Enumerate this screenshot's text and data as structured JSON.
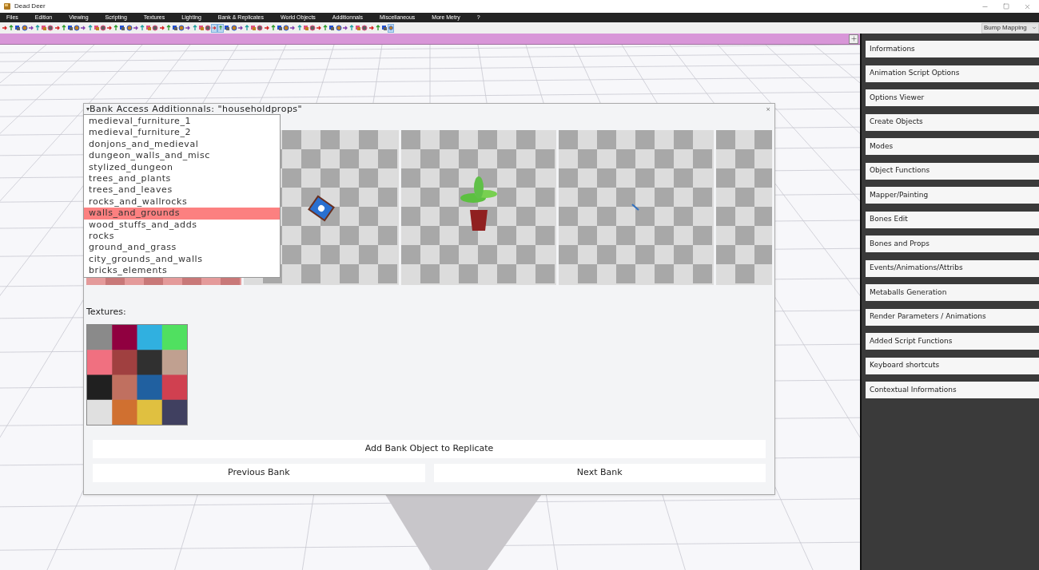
{
  "window": {
    "title": "Dead Deer"
  },
  "menu": [
    "Files",
    "Edition",
    "Viewing",
    "Scripting",
    "Textures",
    "Lighting",
    "Bank & Replicates",
    "World Objects",
    "Additionnals",
    "Miscellaneous",
    "More Metry",
    "?"
  ],
  "toolbar": {
    "tools": [
      {
        "selected": false
      },
      {
        "selected": false
      },
      {
        "selected": false
      },
      {
        "selected": false
      },
      {
        "selected": false
      },
      {
        "selected": false
      },
      {
        "selected": false
      },
      {
        "selected": false
      },
      {
        "selected": false
      },
      {
        "selected": false
      },
      {
        "selected": false
      },
      {
        "selected": false
      },
      {
        "selected": false
      },
      {
        "selected": false
      },
      {
        "selected": false
      },
      {
        "selected": false
      },
      {
        "selected": false
      },
      {
        "selected": false
      },
      {
        "selected": false
      },
      {
        "selected": false
      },
      {
        "selected": false
      },
      {
        "selected": false
      },
      {
        "selected": false
      },
      {
        "selected": false
      },
      {
        "selected": false
      },
      {
        "selected": false
      },
      {
        "selected": false
      },
      {
        "selected": false
      },
      {
        "selected": false
      },
      {
        "selected": false
      },
      {
        "selected": false
      },
      {
        "selected": false
      },
      {
        "selected": true
      },
      {
        "selected": true
      },
      {
        "selected": false
      },
      {
        "selected": false
      },
      {
        "selected": false
      },
      {
        "selected": false
      },
      {
        "selected": false
      },
      {
        "selected": false
      },
      {
        "selected": false
      },
      {
        "selected": false
      },
      {
        "selected": false
      },
      {
        "selected": false
      },
      {
        "selected": false
      },
      {
        "selected": false
      },
      {
        "selected": false
      },
      {
        "selected": false
      },
      {
        "selected": false
      },
      {
        "selected": false
      },
      {
        "selected": false
      },
      {
        "selected": false
      },
      {
        "selected": false
      },
      {
        "selected": false
      },
      {
        "selected": false
      },
      {
        "selected": false
      },
      {
        "selected": false
      },
      {
        "selected": false
      },
      {
        "selected": false
      },
      {
        "selected": true
      }
    ],
    "render_mode": "Bump Mapping"
  },
  "dialog": {
    "toggle": "▾",
    "title": "Bank Access Additionnals: \"householdprops\"",
    "close": "×",
    "banks": [
      {
        "label": "medieval_furniture_1",
        "selected": false
      },
      {
        "label": "medieval_furniture_2",
        "selected": false
      },
      {
        "label": "donjons_and_medieval",
        "selected": false
      },
      {
        "label": "dungeon_walls_and_misc",
        "selected": false
      },
      {
        "label": "stylized_dungeon",
        "selected": false
      },
      {
        "label": "trees_and_plants",
        "selected": false
      },
      {
        "label": "trees_and_leaves",
        "selected": false
      },
      {
        "label": "rocks_and_wallrocks",
        "selected": false
      },
      {
        "label": "walls_and_grounds",
        "selected": true
      },
      {
        "label": "wood_stuffs_and_adds",
        "selected": false
      },
      {
        "label": "rocks",
        "selected": false
      },
      {
        "label": "ground_and_grass",
        "selected": false
      },
      {
        "label": "city_grounds_and_walls",
        "selected": false
      },
      {
        "label": "bricks_elements",
        "selected": false
      }
    ],
    "textures_label": "Textures:",
    "add_button": "Add Bank Object to Replicate",
    "previous_button": "Previous Bank",
    "next_button": "Next Bank"
  },
  "side_panel": [
    "Informations",
    "Animation Script Options",
    "Options Viewer",
    "Create Objects",
    "Modes",
    "Object Functions",
    "Mapper/Painting",
    "Bones Edit",
    "Bones and Props",
    "Events/Animations/Attribs",
    "Metaballs Generation",
    "Render Parameters / Animations",
    "Added Script Functions",
    "Keyboard shortcuts",
    "Contextual Informations"
  ]
}
